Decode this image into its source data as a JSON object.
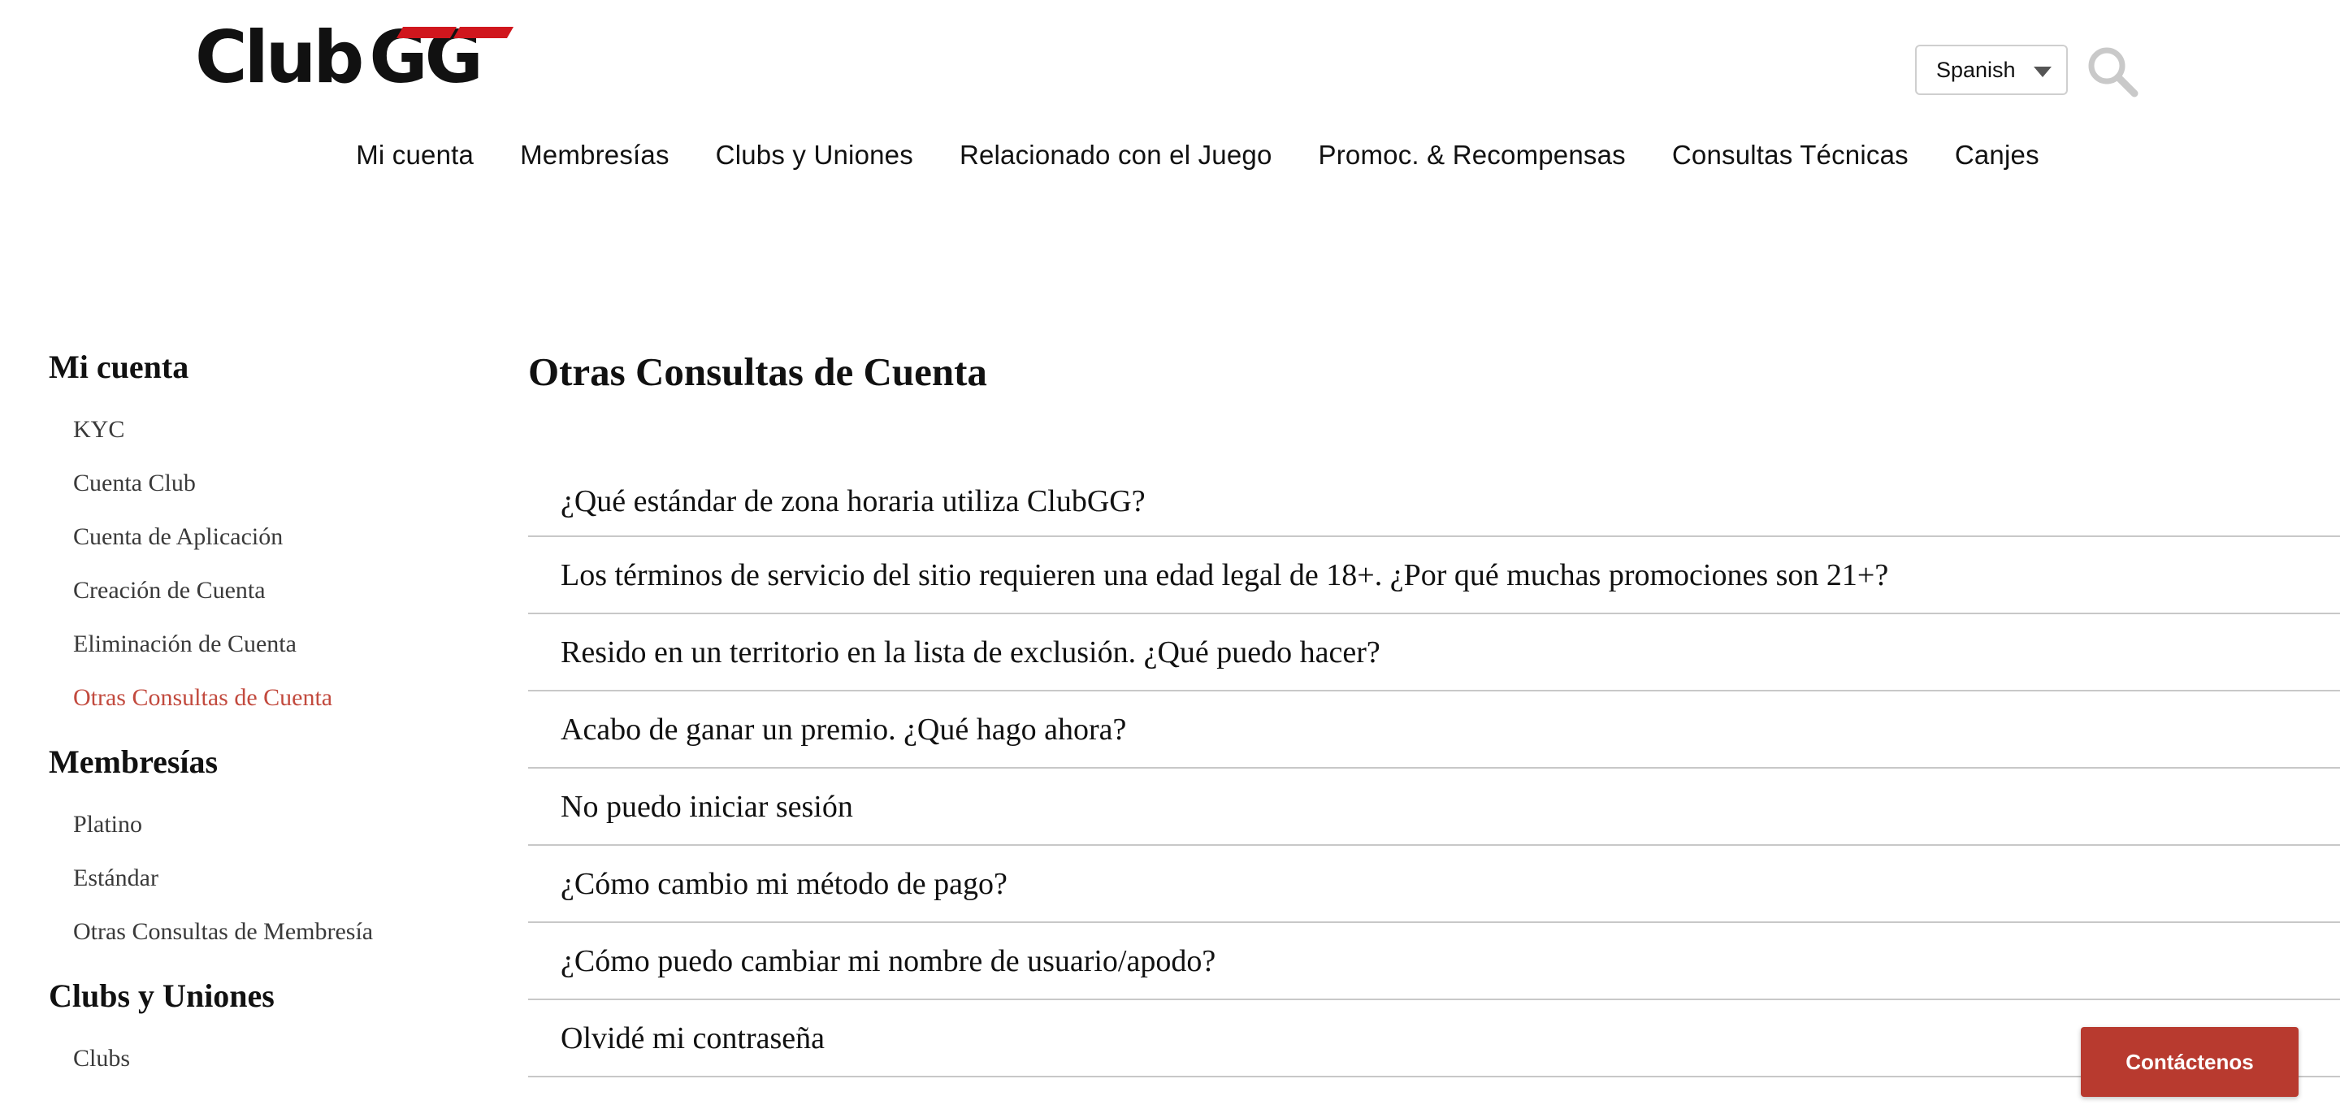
{
  "brand": {
    "logo_text": "Club",
    "logo_gg": "GG"
  },
  "header": {
    "language": "Spanish",
    "nav": [
      "Mi cuenta",
      "Membresías",
      "Clubs y Uniones",
      "Relacionado con el Juego",
      "Promoc. & Recompensas",
      "Consultas Técnicas",
      "Canjes"
    ]
  },
  "sidebar": {
    "groups": [
      {
        "heading": "Mi cuenta",
        "items": [
          "KYC",
          "Cuenta Club",
          "Cuenta de Aplicación",
          "Creación de Cuenta",
          "Eliminación de Cuenta",
          "Otras Consultas de Cuenta"
        ]
      },
      {
        "heading": "Membresías",
        "items": [
          "Platino",
          "Estándar",
          "Otras Consultas de Membresía"
        ]
      },
      {
        "heading": "Clubs y Uniones",
        "items": [
          "Clubs"
        ]
      }
    ],
    "active_item": "Otras Consultas de Cuenta"
  },
  "main": {
    "title": "Otras Consultas de Cuenta",
    "faqs": [
      "¿Qué estándar de zona horaria utiliza ClubGG?",
      "Los términos de servicio del sitio requieren una edad legal de 18+. ¿Por qué muchas promociones son 21+?",
      "Resido en un territorio en la lista de exclusión. ¿Qué puedo hacer?",
      "Acabo de ganar un premio. ¿Qué hago ahora?",
      "No puedo iniciar sesión",
      "¿Cómo cambio mi método de pago?",
      "¿Cómo puedo cambiar mi nombre de usuario/apodo?",
      "Olvidé mi contraseña"
    ]
  },
  "contact_button": "Contáctenos",
  "colors": {
    "accent": "#c24a3e",
    "button": "#b83a2f",
    "logo_red": "#d0161d"
  },
  "icons": [
    "search-icon",
    "chevron-down-icon"
  ]
}
